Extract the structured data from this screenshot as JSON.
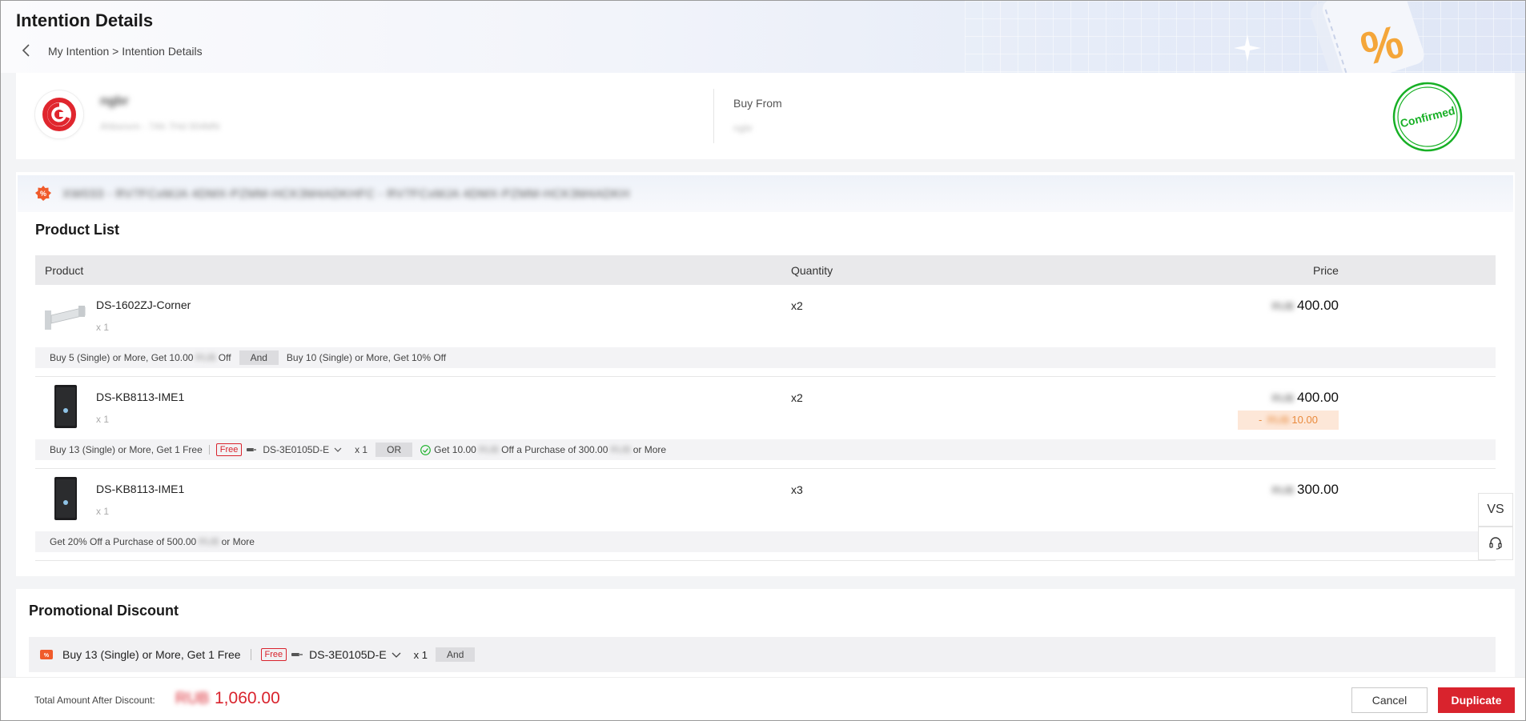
{
  "header": {
    "title": "Intention Details",
    "breadcrumb": "My Intention > Intention Details"
  },
  "seller": {
    "name": "ngbr",
    "subtitle": "Ahbsnvm - 7Ah 7Hd 004MN",
    "buy_from_label": "Buy From",
    "buy_from_value": "ngbr",
    "status_stamp": "Confirmed"
  },
  "promo_banner_text": "XW033 - RV7FCxMJA 4DMX-PZMM-HCK3M4ADKHFC - RV7FCxMJA 4DMX-PZMM-HCK3M4ADKH",
  "product_list": {
    "title": "Product List",
    "columns": {
      "product": "Product",
      "quantity": "Quantity",
      "price": "Price"
    },
    "rows": [
      {
        "name": "DS-1602ZJ-Corner",
        "unit_qty": "x 1",
        "qty": "x2",
        "currency": "RUB",
        "price": "400.00",
        "rules": {
          "rule1": "Buy 5 (Single) or More, Get 10.00",
          "rule1_cur": "RUB",
          "rule1_tail": "Off",
          "connector": "And",
          "rule2": "Buy 10 (Single) or More, Get 10% Off"
        }
      },
      {
        "name": "DS-KB8113-IME1",
        "unit_qty": "x 1",
        "qty": "x2",
        "currency": "RUB",
        "price": "400.00",
        "discount_prefix": "- ",
        "discount_cur": "RUB",
        "discount": "10.00",
        "rules": {
          "rule1": "Buy 13 (Single) or More, Get 1 Free",
          "free_tag": "Free",
          "gift_model": "DS-3E0105D-E",
          "gift_qty": "x 1",
          "connector": "OR",
          "rule2_a": "Get 10.00",
          "rule2_cur": "RUB",
          "rule2_b": "Off a Purchase of 300.00",
          "rule2_cur2": "RUB",
          "rule2_c": "or More"
        }
      },
      {
        "name": "DS-KB8113-IME1",
        "unit_qty": "x 1",
        "qty": "x3",
        "currency": "RUB",
        "price": "300.00",
        "rules": {
          "rule1": "Get 20% Off a Purchase of 500.00",
          "rule1_cur": "RUB",
          "rule1_tail": "or More"
        }
      }
    ]
  },
  "promotional_discount": {
    "title": "Promotional Discount",
    "rule": "Buy 13 (Single) or More, Get 1 Free",
    "free_tag": "Free",
    "gift_model": "DS-3E0105D-E",
    "gift_qty": "x 1",
    "connector": "And"
  },
  "footer": {
    "total_label": "Total Amount After Discount:",
    "total_currency": "RUB",
    "total_value": "1,060.00",
    "cancel_label": "Cancel",
    "duplicate_label": "Duplicate"
  },
  "side_buttons": {
    "vs_label": "VS",
    "support_icon": "headset-icon"
  },
  "colors": {
    "brand_red": "#d9232d",
    "stamp_green": "#17b025",
    "discount_orange": "#e98a3c"
  }
}
